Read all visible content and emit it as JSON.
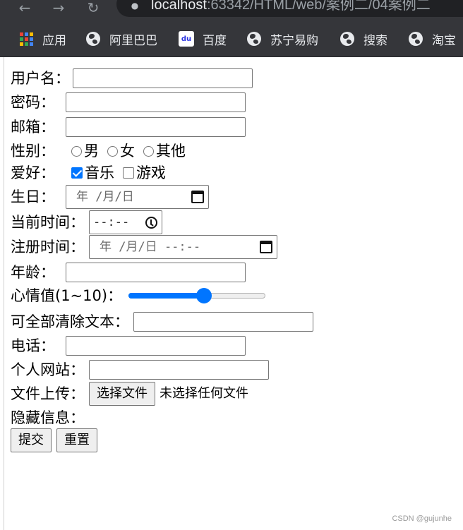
{
  "browser": {
    "url_host": "localhost",
    "url_rest": ":63342/HTML/web/案例二/04案例二",
    "bookmarks": [
      {
        "label": "应用",
        "icon": "apps-grid-icon"
      },
      {
        "label": "阿里巴巴",
        "icon": "globe-icon"
      },
      {
        "label": "百度",
        "icon": "baidu-paw-icon"
      },
      {
        "label": "苏宁易购",
        "icon": "globe-icon"
      },
      {
        "label": "搜索",
        "icon": "globe-icon"
      },
      {
        "label": "淘宝",
        "icon": "globe-icon"
      }
    ]
  },
  "form": {
    "username_label": "用户名：",
    "password_label": "密码：",
    "email_label": "邮箱：",
    "gender_label": "性别：",
    "gender_options": [
      "男",
      "女",
      "其他"
    ],
    "hobby_label": "爱好：",
    "hobby_options": [
      {
        "label": "音乐",
        "checked": true
      },
      {
        "label": "游戏",
        "checked": false
      }
    ],
    "birthday_label": "生日：",
    "birthday_value": "年 /月/日",
    "time_label": "当前时间：",
    "time_value": "--:--",
    "register_label": "注册时间：",
    "register_value": "年 /月/日 --:--",
    "age_label": "年龄：",
    "mood_label": "心情值(1~10)：",
    "mood_min": 1,
    "mood_max": 10,
    "mood_value": 6,
    "search_label": "可全部清除文本：",
    "phone_label": "电话：",
    "website_label": "个人网站：",
    "upload_label": "文件上传：",
    "upload_button": "选择文件",
    "upload_status": "未选择任何文件",
    "hidden_label": "隐藏信息：",
    "submit_label": "提交",
    "reset_label": "重置"
  },
  "watermark": "CSDN @gujunhe",
  "colors": {
    "accent": "#0075ff",
    "chrome_bg": "#35363a"
  }
}
